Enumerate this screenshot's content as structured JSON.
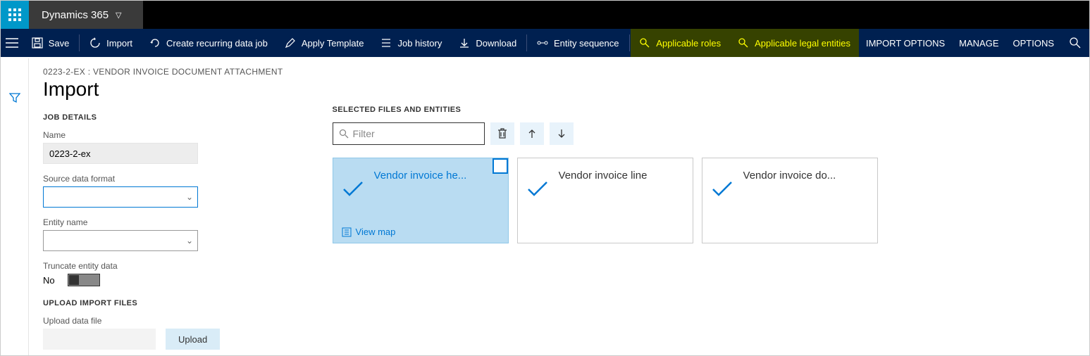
{
  "header": {
    "brand": "Dynamics 365"
  },
  "actionbar": {
    "save": "Save",
    "import": "Import",
    "recurring": "Create recurring data job",
    "apply_template": "Apply Template",
    "job_history": "Job history",
    "download": "Download",
    "entity_sequence": "Entity sequence",
    "applicable_roles": "Applicable roles",
    "applicable_entities": "Applicable legal entities",
    "import_options": "IMPORT OPTIONS",
    "manage": "MANAGE",
    "options": "OPTIONS"
  },
  "page": {
    "breadcrumb": "0223-2-EX : VENDOR INVOICE DOCUMENT ATTACHMENT",
    "title": "Import"
  },
  "job_details": {
    "section": "JOB DETAILS",
    "name_label": "Name",
    "name_value": "0223-2-ex",
    "source_format_label": "Source data format",
    "source_format_value": "",
    "entity_name_label": "Entity name",
    "entity_name_value": "",
    "truncate_label": "Truncate entity data",
    "truncate_value": "No"
  },
  "upload": {
    "section": "UPLOAD IMPORT FILES",
    "label": "Upload data file",
    "button": "Upload"
  },
  "entities": {
    "section": "SELECTED FILES AND ENTITIES",
    "filter_placeholder": "Filter",
    "view_map": "View map",
    "cards": [
      {
        "title": "Vendor invoice he...",
        "selected": true
      },
      {
        "title": "Vendor invoice line",
        "selected": false
      },
      {
        "title": "Vendor invoice do...",
        "selected": false
      }
    ]
  }
}
